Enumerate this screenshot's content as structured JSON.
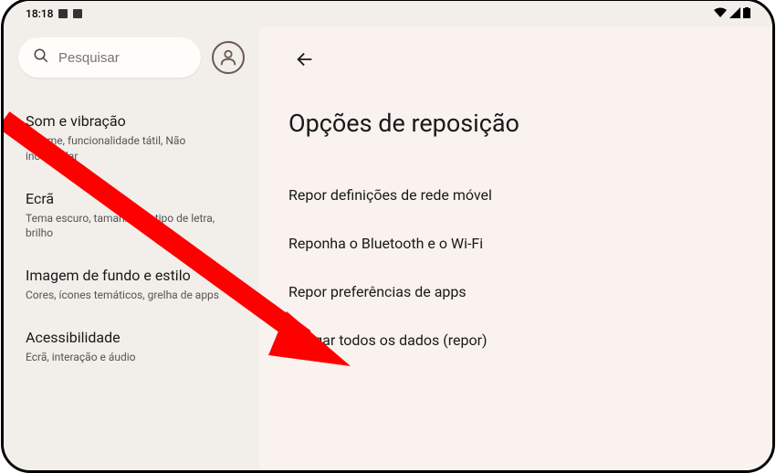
{
  "status_bar": {
    "time": "18:18"
  },
  "search": {
    "placeholder": "Pesquisar"
  },
  "sidebar": {
    "items": [
      {
        "title": "Som e vibração",
        "subtitle": "Volume, funcionalidade tátil, Não incomodar"
      },
      {
        "title": "Ecrã",
        "subtitle": "Tema escuro, tamanho do tipo de letra, brilho"
      },
      {
        "title": "Imagem de fundo e estilo",
        "subtitle": "Cores, ícones temáticos, grelha de apps"
      },
      {
        "title": "Acessibilidade",
        "subtitle": "Ecrã, interação e áudio"
      }
    ]
  },
  "main": {
    "title": "Opções de reposição",
    "options": [
      "Repor definições de rede móvel",
      "Reponha o Bluetooth e o Wi-Fi",
      "Repor preferências de apps",
      "Apagar todos os dados (repor)"
    ]
  }
}
